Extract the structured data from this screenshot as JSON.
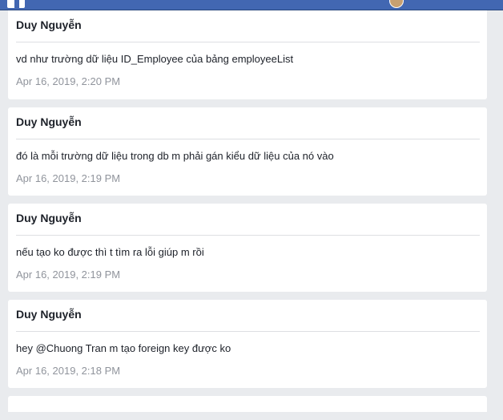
{
  "header": {
    "logo_icon": "facebook-f-icon",
    "avatar_icon": "profile-avatar"
  },
  "posts": [
    {
      "author": "Duy Nguyễn",
      "message": "vd như trường dữ liệu ID_Employee của bảng employeeList",
      "timestamp": "Apr 16, 2019, 2:20 PM"
    },
    {
      "author": "Duy Nguyễn",
      "message": "đó là mỗi trường dữ liệu trong db m phải gán kiểu dữ liệu của nó vào",
      "timestamp": "Apr 16, 2019, 2:19 PM"
    },
    {
      "author": "Duy Nguyễn",
      "message": "nếu tạo ko được thì t tìm ra lỗi giúp m rồi",
      "timestamp": "Apr 16, 2019, 2:19 PM"
    },
    {
      "author": "Duy Nguyễn",
      "message": "hey @Chuong Tran m tạo foreign key được ko",
      "timestamp": "Apr 16, 2019, 2:18 PM"
    }
  ],
  "colors": {
    "topbar": "#4267b2",
    "background": "#e9ebee",
    "card": "#ffffff",
    "text": "#1d2129",
    "timestamp": "#90949c",
    "divider": "#dddfe2"
  }
}
